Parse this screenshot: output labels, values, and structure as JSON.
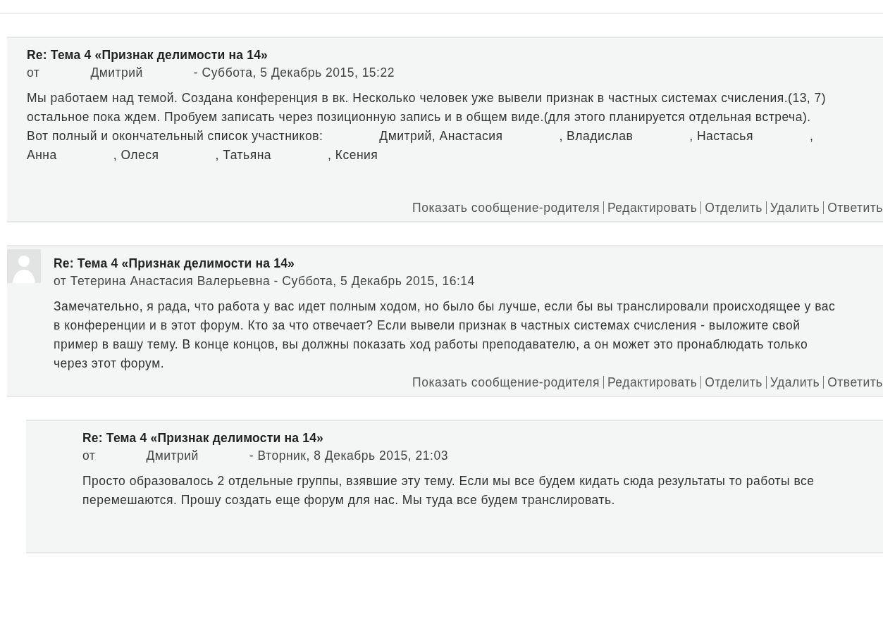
{
  "posts": [
    {
      "subject": "Re: Тема 4 «Признак делимости на 14»",
      "avatar": false,
      "author": [
        "от",
        "Дмитрий",
        "- Суббота, 5 Декабрь 2015, 15:22"
      ],
      "body": [
        "Мы работаем над темой. Создана конференция в вк. Несколько человек уже вывели признак в частных системах счисления.(13, 7) остальное пока ждем. Пробуем записать через позиционную запись и в общем виде.(для этого планируется отдельная встреча). Вот полный и окончательный список участников:",
        "Дмитрий, Анастасия",
        ", Владислав",
        ", Настасья",
        ", Анна",
        ", Олеся",
        ", Татьяна",
        ", Ксения"
      ],
      "actions": [
        "Показать сообщение-родителя",
        "Редактировать",
        "Отделить",
        "Удалить",
        "Ответить"
      ]
    },
    {
      "subject": "Re: Тема 4 «Признак делимости на 14»",
      "avatar": true,
      "author": [
        "от Тетерина Анастасия Валерьевна - Суббота, 5 Декабрь 2015, 16:14"
      ],
      "body": [
        "Замечательно, я рада, что работа у вас идет полным ходом, но было бы лучше, если бы вы транслировали происходящее у вас в конференции и в этот форум. Кто за что отвечает? Если вывели признак в частных системах счисления - выложите свой пример в вашу тему. В конце концов, вы должны показать ход работы преподавателю, а он может это пронаблюдать только через этот форум."
      ],
      "actions": [
        "Показать сообщение-родителя",
        "Редактировать",
        "Отделить",
        "Удалить",
        "Ответить"
      ],
      "children": [
        {
          "subject": "Re: Тема 4 «Признак делимости на 14»",
          "avatar": false,
          "author": [
            "от",
            "Дмитрий",
            "- Вторник, 8 Декабрь 2015, 21:03"
          ],
          "body": [
            "Просто образовалось 2 отдельные группы, взявшие эту тему. Если мы все будем кидать сюда результаты то работы все перемешаются. Прошу создать еще форум для нас. Мы туда все будем транслировать."
          ]
        }
      ]
    }
  ]
}
